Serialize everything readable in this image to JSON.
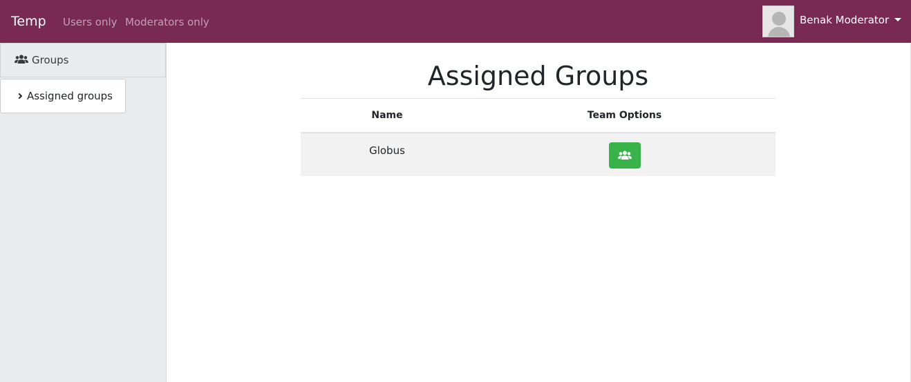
{
  "navbar": {
    "brand": "Temp",
    "links": [
      "Users only",
      "Moderators only"
    ],
    "user_name": "Benak Moderator",
    "background": "#782a53"
  },
  "sidebar": {
    "header": {
      "label": "Groups",
      "icon": "users-icon"
    },
    "items": [
      {
        "label": "Assigned groups",
        "icon": "chevron-right-icon"
      }
    ]
  },
  "main": {
    "title": "Assigned Groups",
    "table": {
      "columns": [
        "Name",
        "Team Options"
      ],
      "rows": [
        {
          "name": "Globus",
          "option_icon": "users-icon",
          "option_color": "#37b34a"
        }
      ]
    }
  }
}
